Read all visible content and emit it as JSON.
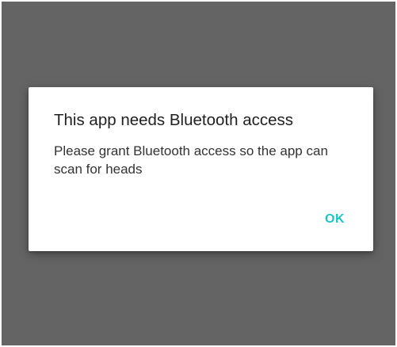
{
  "colors": {
    "scrim": "#646464",
    "dialog_background": "#ffffff",
    "accent": "#19c8c6",
    "title_text": "#212121",
    "body_text": "#333333"
  },
  "dialog": {
    "title": "This app needs Bluetooth access",
    "message": "Please grant Bluetooth access so the app can scan for heads",
    "ok_label": "OK"
  }
}
